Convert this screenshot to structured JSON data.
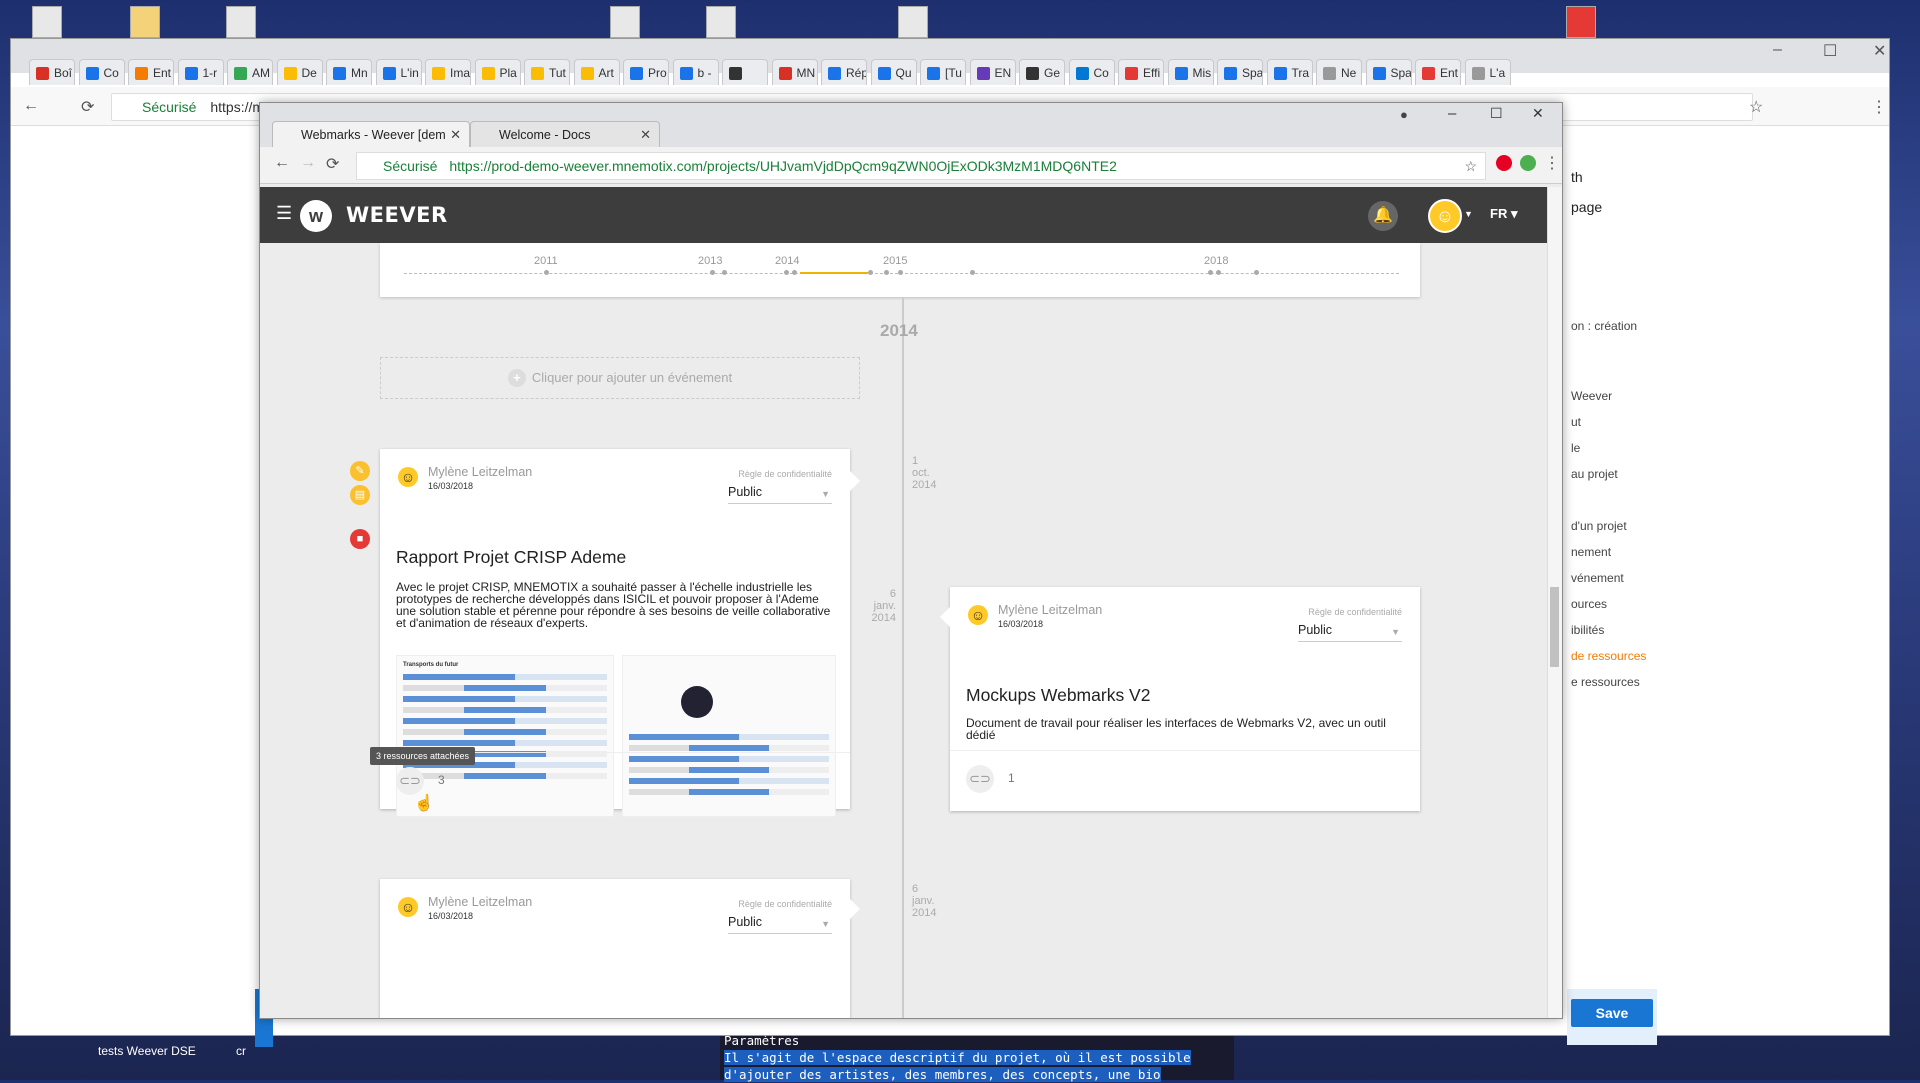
{
  "desktop": {
    "taskbar_label_1": "tests Weever DSE",
    "taskbar_label_2": "cr",
    "console_line_1": "Paramètres",
    "console_line_2": "Il s'agit de l'espace descriptif du projet, où il est possible",
    "console_line_3": "d'ajouter des artistes, des membres, des concepts, une bio"
  },
  "outer_browser": {
    "tabs": [
      "Boî",
      "Co",
      "Ent",
      "1-r",
      "AM",
      "De",
      "Mn",
      "L'in",
      "Ima",
      "Pla",
      "Tut",
      "Art",
      "Pro",
      "b -",
      "",
      "MN",
      "Rép",
      "Qu",
      "[Tu",
      "EN",
      "Ge",
      "Co",
      "Effi",
      "Mis",
      "Spa",
      "Tra",
      "Ne",
      "Spa",
      "Ent",
      "L'a"
    ],
    "secure_label": "Sécurisé",
    "url_prefix": "https://m",
    "right_panel": [
      "th",
      "page",
      "on : création",
      "Weever",
      "ut",
      "le",
      "au projet",
      "d'un projet",
      "nement",
      "vénement",
      "ources",
      "ibilités",
      "de ressources",
      "e ressources"
    ],
    "save_label": "Save"
  },
  "inner_browser": {
    "tabs": [
      {
        "label": "Webmarks - Weever [dem",
        "active": true
      },
      {
        "label": "Welcome - Docs",
        "active": false
      }
    ],
    "secure_label": "Sécurisé",
    "url": "https://prod-demo-weever.mnemotix.com/projects/UHJvamVjdDpQcm9qZWN0OjExODk3MzM1MDQ6NTE2"
  },
  "app": {
    "brand": "WEEVER",
    "lang": "FR",
    "timeline_years": [
      "2011",
      "2013",
      "2014",
      "2015",
      "2018"
    ],
    "current_year": "2014",
    "add_event_label": "Cliquer pour ajouter un événement",
    "cards": [
      {
        "author": "Mylène Leitzelman",
        "date": "16/03/2018",
        "privacy_label": "Règle de confidentialité",
        "privacy": "Public",
        "title": "Rapport Projet CRISP Ademe",
        "description": "Avec le projet CRISP, MNEMOTIX a souhaité passer à l'échelle industrielle les prototypes de recherche développés dans ISICIL et pouvoir proposer à l'Ademe une solution stable et pérenne pour répondre à ses besoins de veille collaborative et d'animation de réseaux d'experts.",
        "attachments": "3",
        "tooltip": "3 ressources attachées",
        "timeline_date": [
          "1",
          "oct.",
          "2014"
        ]
      },
      {
        "author": "Mylène Leitzelman",
        "date": "16/03/2018",
        "privacy_label": "Règle de confidentialité",
        "privacy": "Public",
        "title": "Mockups Webmarks V2",
        "description": "Document de travail pour réaliser les interfaces de Webmarks V2, avec un outil dédié",
        "attachments": "1",
        "timeline_date": [
          "6",
          "janv.",
          "2014"
        ]
      },
      {
        "author": "Mylène Leitzelman",
        "date": "16/03/2018",
        "privacy_label": "Règle de confidentialité",
        "privacy": "Public",
        "timeline_date": [
          "6",
          "janv.",
          "2014"
        ]
      }
    ],
    "screenshot_heading": "Transports du futur"
  }
}
